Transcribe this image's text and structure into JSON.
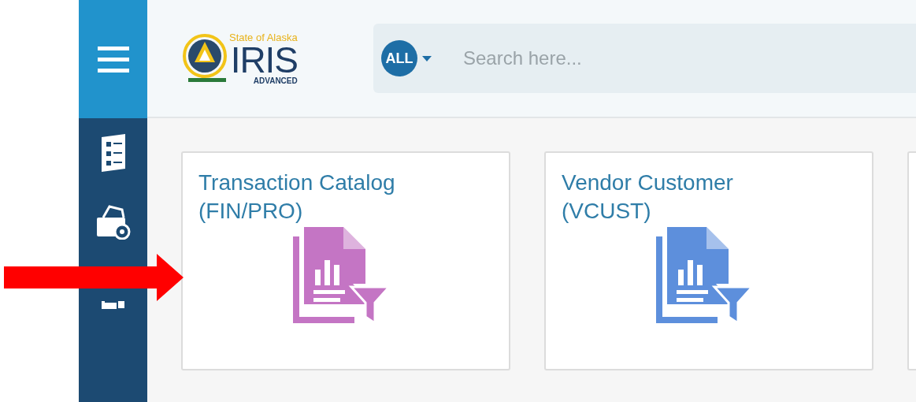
{
  "logo": {
    "subtitle": "State of Alaska",
    "name": "IRIS",
    "tagline": "ADVANCED"
  },
  "search": {
    "scope": "ALL",
    "placeholder": "Search here..."
  },
  "cards": [
    {
      "title": "Transaction Catalog (FIN/PRO)",
      "color": "#c475c4"
    },
    {
      "title": "Vendor Customer (VCUST)",
      "color": "#5d8fdc"
    }
  ]
}
